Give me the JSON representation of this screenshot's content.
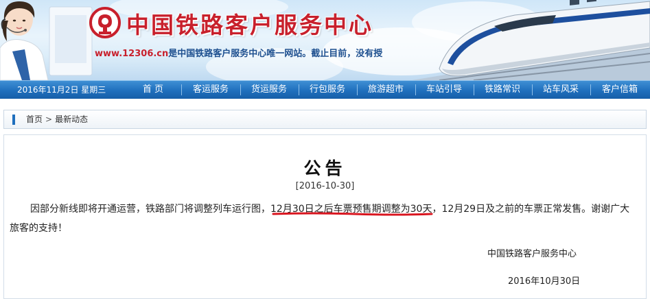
{
  "header": {
    "site_title": "中国铁路客户服务中心",
    "tagline_url": "www.12306.cn",
    "tagline_text": "是中国铁路客户服务中心唯一网站。截止目前，没有授",
    "colors": {
      "title_red": "#c8202c",
      "nav_blue": "#1f6fbd"
    },
    "icons": [
      "railway-logo-icon",
      "customer-service-operator",
      "high-speed-train"
    ]
  },
  "nav": {
    "date": "2016年11月2日 星期三",
    "items": [
      "首 页",
      "客运服务",
      "货运服务",
      "行包服务",
      "旅游超市",
      "车站引导",
      "铁路常识",
      "站车风采",
      "客户信箱"
    ]
  },
  "breadcrumb": {
    "home": "首页",
    "separator": ">",
    "current": "最新动态"
  },
  "notice": {
    "title": "公告",
    "date": "[2016-10-30]",
    "body_before": "因部分新线即将开通运营，铁路部门将调整列车运行图，",
    "body_highlight": "12月30日之后车票预售期调整为30天",
    "body_after": "，12月29日及之前的车票正常发售。谢谢广大旅客的支持！",
    "signature": "中国铁路客户服务中心",
    "sign_date": "2016年10月30日"
  }
}
